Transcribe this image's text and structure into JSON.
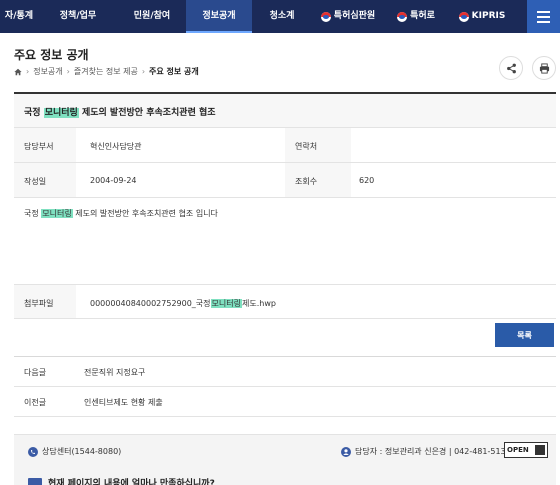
{
  "topnav": {
    "items": [
      "자/통계",
      "정책/업무",
      "민원/참여",
      "정보공개",
      "청소계"
    ],
    "external": [
      "특허심판원",
      "특허로",
      "KIPRIS"
    ],
    "active_index": 3
  },
  "page": {
    "title": "주요 정보 공개",
    "breadcrumb": [
      "정보공개",
      "즐겨찾는 정보 제공",
      "주요 정보 공개"
    ]
  },
  "post": {
    "title_prefix": "국정 ",
    "title_highlight": "모니터링",
    "title_suffix": " 제도의 발전방안 후속조치관련 협조",
    "dept_label": "담당부서",
    "dept_value": "혁신인사담당관",
    "contact_label": "연락처",
    "contact_value": "",
    "date_label": "작성일",
    "date_value": "2004-09-24",
    "views_label": "조회수",
    "views_value": "620",
    "body_prefix": "국정 ",
    "body_highlight": "모니터링",
    "body_suffix": " 제도의 발전방안 후속조치관련 협조 입니다",
    "attach_label": "첨부파일",
    "attach_prefix": "0000004084000275290​0_국정",
    "attach_highlight": "모니터링",
    "attach_suffix": "제도.hwp"
  },
  "list_button": "목록",
  "nav": {
    "next_label": "다음글",
    "next_value": "전문직위 지정요구",
    "prev_label": "이전글",
    "prev_value": "인센티브제도 현황 제출"
  },
  "footer": {
    "call_center": "상담센터(1544-8080)",
    "manager": "담당자 : 정보관리과 신은경 | 042-481-5136",
    "open_badge": "OPEN",
    "survey": "현재 페이지의 내용에 얼마나 만족하십니까?"
  }
}
